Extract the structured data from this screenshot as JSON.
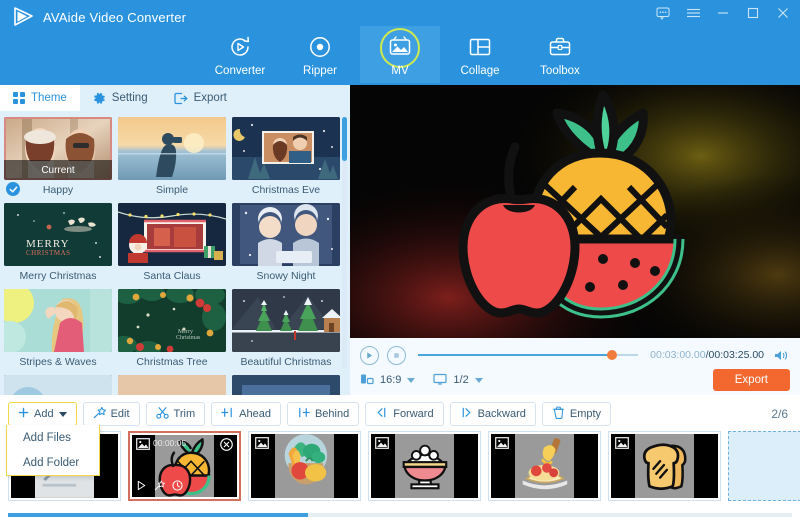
{
  "app": {
    "title": "AVAide Video Converter",
    "logo_icon": "play-triangle-logo"
  },
  "window_controls": [
    {
      "name": "feedback-icon",
      "glyph": "feedback"
    },
    {
      "name": "menu-icon",
      "glyph": "hamburger"
    },
    {
      "name": "minimize-icon",
      "glyph": "minimize"
    },
    {
      "name": "maximize-icon",
      "glyph": "maximize"
    },
    {
      "name": "close-icon",
      "glyph": "close"
    }
  ],
  "nav": {
    "active": "MV",
    "tabs": [
      {
        "label": "Converter",
        "icon": "convert-refresh-icon"
      },
      {
        "label": "Ripper",
        "icon": "disc-icon"
      },
      {
        "label": "MV",
        "icon": "picture-frame-icon"
      },
      {
        "label": "Collage",
        "icon": "grid-layout-icon"
      },
      {
        "label": "Toolbox",
        "icon": "toolbox-icon"
      }
    ]
  },
  "left_panel": {
    "subtabs": [
      {
        "label": "Theme",
        "icon": "grid-dots-icon",
        "active": true
      },
      {
        "label": "Setting",
        "icon": "gear-icon",
        "active": false
      },
      {
        "label": "Export",
        "icon": "export-arrow-icon",
        "active": false
      }
    ],
    "current_badge": "Current",
    "themes": [
      [
        {
          "label": "Happy",
          "selected": true,
          "art": "happy"
        },
        {
          "label": "Simple",
          "selected": false,
          "art": "simple"
        },
        {
          "label": "Christmas Eve",
          "selected": false,
          "art": "xmas-eve"
        }
      ],
      [
        {
          "label": "Merry Christmas",
          "selected": false,
          "art": "merry"
        },
        {
          "label": "Santa Claus",
          "selected": false,
          "art": "santa"
        },
        {
          "label": "Snowy Night",
          "selected": false,
          "art": "snowy"
        }
      ],
      [
        {
          "label": "Stripes & Waves",
          "selected": false,
          "art": "stripes"
        },
        {
          "label": "Christmas Tree",
          "selected": false,
          "art": "tree"
        },
        {
          "label": "Beautiful Christmas",
          "selected": false,
          "art": "beautiful"
        }
      ]
    ]
  },
  "preview": {
    "art": "fruit-pineapple-apple-watermelon"
  },
  "player": {
    "play_icon": "play-icon",
    "stop_icon": "stop-icon",
    "progress_percent": 88,
    "current_time": "00:03:00.00",
    "separator": "/",
    "duration": "00:03:25.00",
    "volume_icon": "speaker-icon",
    "aspect_ratio": {
      "icon": "aspect-icon",
      "value": "16:9"
    },
    "screen_split": {
      "icon": "monitor-icon",
      "value": "1/2"
    },
    "export_label": "Export"
  },
  "toolbar": {
    "buttons": [
      {
        "label": "Add",
        "icon": "plus-icon",
        "has_caret": true,
        "highlight": true
      },
      {
        "label": "Edit",
        "icon": "magic-wand-icon",
        "has_caret": false,
        "highlight": false
      },
      {
        "label": "Trim",
        "icon": "scissors-icon",
        "has_caret": false,
        "highlight": false
      },
      {
        "label": "Ahead",
        "icon": "insert-ahead-icon",
        "has_caret": false,
        "highlight": false
      },
      {
        "label": "Behind",
        "icon": "insert-behind-icon",
        "has_caret": false,
        "highlight": false
      },
      {
        "label": "Forward",
        "icon": "move-forward-icon",
        "has_caret": false,
        "highlight": false
      },
      {
        "label": "Backward",
        "icon": "move-backward-icon",
        "has_caret": false,
        "highlight": false
      },
      {
        "label": "Empty",
        "icon": "trash-icon",
        "has_caret": false,
        "highlight": false
      }
    ],
    "page_count": "2/6"
  },
  "add_menu": {
    "open": true,
    "items": [
      {
        "label": "Add Files"
      },
      {
        "label": "Add Folder"
      }
    ]
  },
  "filmstrip": {
    "clips": [
      {
        "art": "pen-writing",
        "selected": false,
        "timecode": "",
        "show_overlay": false
      },
      {
        "art": "fruit",
        "selected": true,
        "timecode": "00:00:05",
        "show_overlay": true
      },
      {
        "art": "vegetables",
        "selected": false,
        "timecode": "",
        "show_overlay": false
      },
      {
        "art": "rice-bowl",
        "selected": false,
        "timecode": "",
        "show_overlay": false
      },
      {
        "art": "pasta",
        "selected": false,
        "timecode": "",
        "show_overlay": false
      },
      {
        "art": "bread",
        "selected": false,
        "timecode": "",
        "show_overlay": false
      }
    ],
    "placeholder_icon": "add-placeholder",
    "next_icon": "chevron-right-icon",
    "clip_overlay_icons": [
      "play-small-icon",
      "magic-wand-small-icon",
      "clock-small-icon"
    ],
    "close_icon": "remove-clip-icon",
    "image_badge_icon": "image-badge-icon"
  },
  "colors": {
    "header_blue": "#2b93de",
    "accent_orange": "#f2682f",
    "panel_blue": "#e0f0fb",
    "highlight_yellow": "#f0d74a",
    "ring_green": "#cfe94e"
  }
}
